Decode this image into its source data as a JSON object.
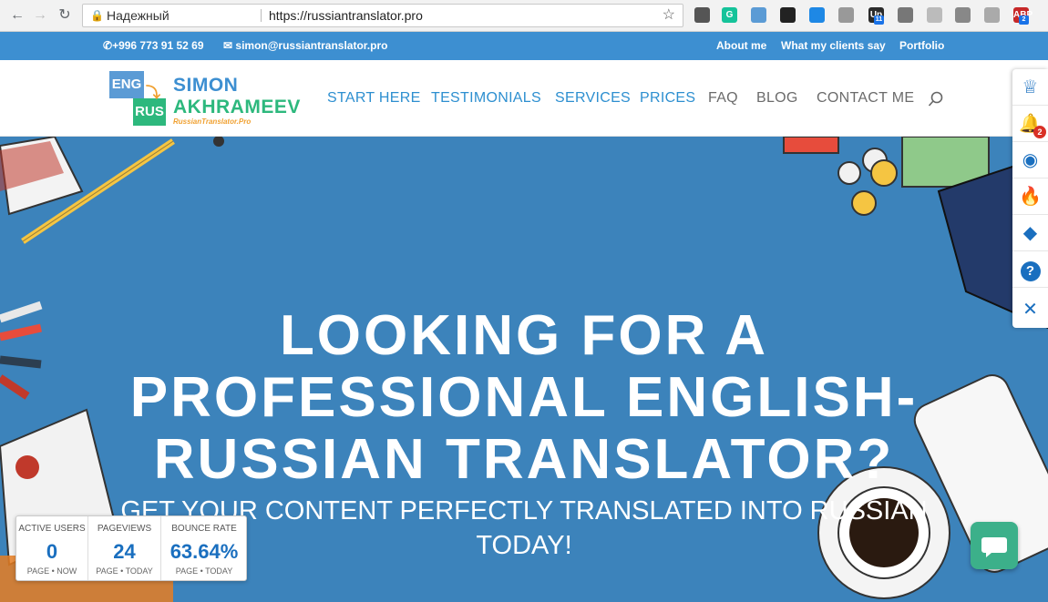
{
  "browser": {
    "secure_label": "Надежный",
    "url": "https://russiantranslator.pro",
    "extensions": [
      {
        "name": "eyedropper-icon",
        "color": "#555555",
        "text": ""
      },
      {
        "name": "grammarly-icon",
        "color": "#15c39a",
        "text": "G"
      },
      {
        "name": "mail-icon",
        "color": "#5b9bd5",
        "text": ""
      },
      {
        "name": "buffer-icon",
        "color": "#222222",
        "text": ""
      },
      {
        "name": "share-icon",
        "color": "#1e88e5",
        "text": ""
      },
      {
        "name": "cup-icon",
        "color": "#999999",
        "text": ""
      },
      {
        "name": "upwork-icon",
        "color": "#2b2b2b",
        "text": "Up"
      },
      {
        "name": "swirl-icon",
        "color": "#777777",
        "text": ""
      },
      {
        "name": "page-icon",
        "color": "#bbbbbb",
        "text": ""
      },
      {
        "name": "contacts-icon",
        "color": "#888888",
        "text": ""
      },
      {
        "name": "drive-icon",
        "color": "#aaaaaa",
        "text": ""
      },
      {
        "name": "abp-icon",
        "color": "#c62828",
        "text": "ABP"
      }
    ],
    "badges": {
      "upwork": "11",
      "abp": "2"
    }
  },
  "topbar": {
    "phone": "+996 773 91 52 69",
    "email": "simon@russiantranslator.pro",
    "links": [
      "About me",
      "What my clients say",
      "Portfolio"
    ]
  },
  "logo": {
    "eng": "ENG",
    "rus": "RUS",
    "name_line1": "SIMON",
    "name_line2": "AKHRAMEEV",
    "tagline": "RussianTranslator.Pro"
  },
  "nav": {
    "start_here": "START HERE",
    "testimonials": "TESTIMONIALS",
    "services": "SERVICES",
    "prices": "PRICES",
    "faq": "FAQ",
    "blog": "BLOG",
    "contact": "CONTACT ME"
  },
  "hero": {
    "title_lines": [
      "LOOKING FOR A",
      "PROFESSIONAL ENGLISH-",
      "RUSSIAN TRANSLATOR?"
    ],
    "subtitle": "GET YOUR CONTENT PERFECTLY TRANSLATED INTO RUSSIAN TODAY!"
  },
  "side_panel": {
    "items": [
      "crown-icon",
      "bell-icon",
      "eye-icon",
      "fire-icon",
      "diamond-icon",
      "help-icon",
      "close-icon"
    ],
    "bell_badge": "2"
  },
  "stats": {
    "active_users": {
      "label": "ACTIVE USERS",
      "value": "0",
      "caption": "PAGE • NOW"
    },
    "pageviews": {
      "label": "PAGEVIEWS",
      "value": "24",
      "caption": "PAGE • TODAY"
    },
    "bounce_rate": {
      "label": "BOUNCE RATE",
      "value": "63.64%",
      "caption": "PAGE • TODAY"
    }
  },
  "colors": {
    "topbar": "#3d8fd1",
    "hero": "#3c83bb",
    "nav_active": "#2d8fd0",
    "brand_green": "#2db87d",
    "chat": "#3cb08a"
  }
}
